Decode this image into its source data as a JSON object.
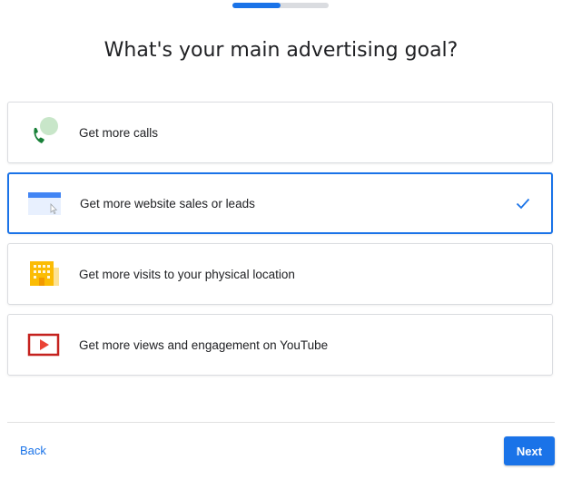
{
  "progress": {
    "fraction": 0.5,
    "fill_color": "#1a73e8",
    "track_color": "#dadce0"
  },
  "title": "What's your main advertising goal?",
  "options": [
    {
      "label": "Get more calls",
      "icon": "phone-icon",
      "selected": false
    },
    {
      "label": "Get more website sales or leads",
      "icon": "website-icon",
      "selected": true
    },
    {
      "label": "Get more visits to your physical location",
      "icon": "store-icon",
      "selected": false
    },
    {
      "label": "Get more views and engagement on YouTube",
      "icon": "youtube-icon",
      "selected": false
    }
  ],
  "footer": {
    "back_label": "Back",
    "next_label": "Next"
  },
  "colors": {
    "accent": "#1a73e8"
  }
}
